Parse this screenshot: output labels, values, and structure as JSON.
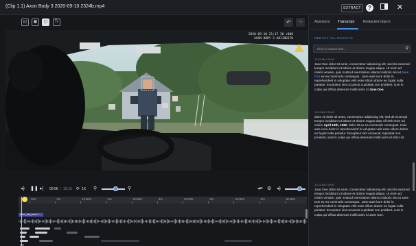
{
  "window": {
    "title": "(Clip 1.1) Axon Body 3 2020-09-10 2324b.mp4",
    "extract_label": "EXTRACT"
  },
  "video": {
    "overlay_line1": "2020-09-10 21:17 36 +000",
    "overlay_line2": "AXON BODY 3 X01180170"
  },
  "playback": {
    "current_time": "00:06",
    "total_time": "10:13",
    "speed": "1X",
    "zoom_level": 0.6,
    "volume_level": 0.7
  },
  "timeline": {
    "ticks": [
      "30s",
      "1m",
      "1m30s",
      "2m",
      "2m30s",
      "3m",
      "3m30s",
      "4m",
      "4m30s",
      "5m",
      "5m30s"
    ],
    "clip_label": "Axon_clip_track 1",
    "playhead_fraction": 0.01
  },
  "panel": {
    "tabs": [
      "Assistant",
      "Transcript",
      "Redacted object"
    ],
    "active_tab": 1,
    "redact_all_label": "REDACT ALL RESULTS",
    "search_placeholder": "Click to search text...",
    "segments": [
      {
        "time": "12:33 AM / 00:00",
        "text_a": "Jane Doe dolor sit amet, consectetur adipiscing elit, sed do eiusmod tempor incididunt ut labore et dolore magna aliqua. Ut enim ad minim veniam, quis nostrud exercitation ullamco laboris nisi ut ",
        "highlight": "Jane Doe",
        "text_b": " ex ea commodo consequat.. Jane aute irure dolor in reprehenderit in voluptate velit esse cillum dolore eu fugiat nulla pariatur. Excepteur sint occaecat cupidatat non proident, sunt in culpa qui officia deserunt mollit anim id ",
        "bold": "Jane Doe."
      },
      {
        "time": "12:33 AM / 00:00",
        "text_a": "dolor sit dolor sit amet, consectetur adipiscing elit, sed do eiusmod tempor incididunt ut labore et dolore magna date of birth enim ad minim ",
        "bold": "April 19th, 1990",
        "text_b": ". dolor sit ex ea commodo consequat. Duis aute irure dolor in reprehenderit in voluptate velit esse cillum dolore eu fugiat nulla pariatur. Excepteur sint occaecat cupidatat non proident, sunt in culpa qui officia deserunt mollit anim id dolor sit."
      },
      {
        "time": "12:33 AM / 00:00",
        "text": "Jane Doe dolor sit amet, consectetur adipiscing elit, sed do eiusmod tempor incididunt ut labore et dolore magna aliqua. Ut enim ad minim veniam, quis nostrud exercitation ullamco laboris nisi ut Jane Doe ex ea commodo consequat.. Jane aute irure dolor in reprehenderit in voluptate velit esse cillum dolore eu fugiat nulla pariatur. Excepteur sint occaecat cupidatat non proident, sunt in culpa qui officia deserunt mollit anim id Jane Doe."
      }
    ]
  }
}
